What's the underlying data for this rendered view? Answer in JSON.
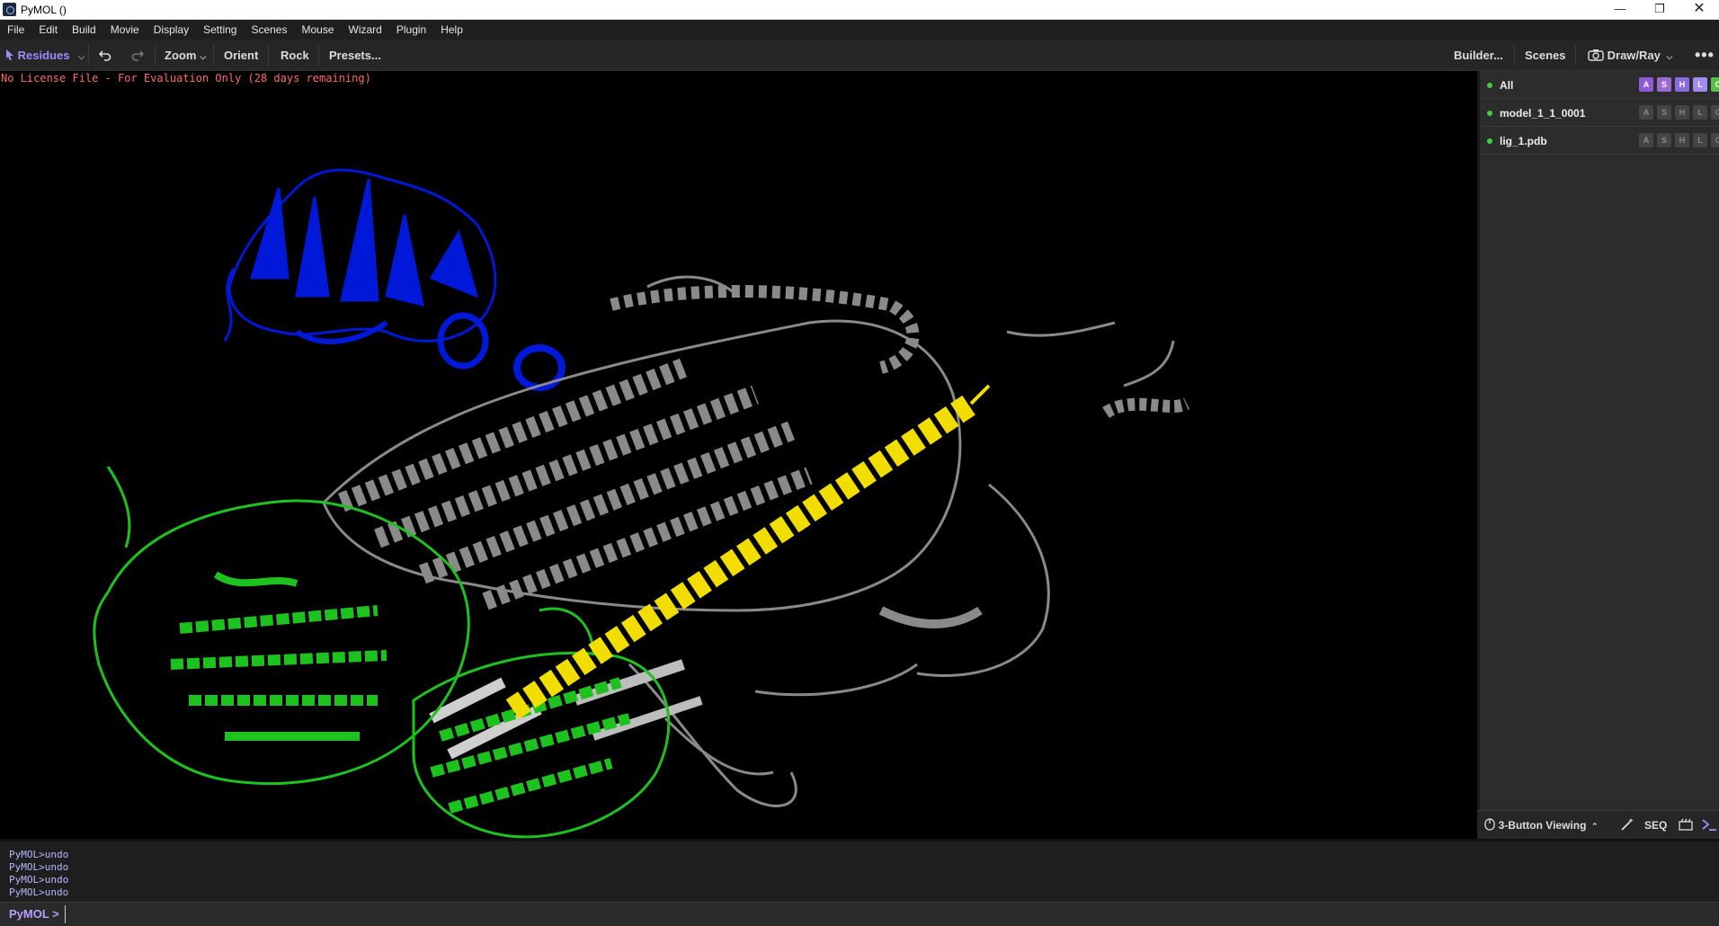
{
  "window": {
    "title": "PyMOL ()",
    "minimize_icon": "minimize-icon",
    "maximize_icon": "restore-icon",
    "close_icon": "close-icon"
  },
  "menu": [
    "File",
    "Edit",
    "Build",
    "Movie",
    "Display",
    "Setting",
    "Scenes",
    "Mouse",
    "Wizard",
    "Plugin",
    "Help"
  ],
  "toolbar": {
    "selection_mode": "Residues",
    "zoom": "Zoom",
    "orient": "Orient",
    "rock": "Rock",
    "presets": "Presets...",
    "builder": "Builder...",
    "scenes": "Scenes",
    "draw_ray": "Draw/Ray",
    "accent": "#9b8cff"
  },
  "viewport": {
    "license_notice": "No License File - For Evaluation Only (28 days remaining)",
    "colors": {
      "chain_blue": "#0018d8",
      "chain_gray": "#8a8a8a",
      "chain_green": "#1ec21e",
      "helix_yellow": "#f2dd00",
      "background": "#000000"
    }
  },
  "objects": [
    {
      "name": "All",
      "buttons": [
        "A",
        "S",
        "H",
        "L",
        "C"
      ],
      "active": true
    },
    {
      "name": "model_1_1_0001",
      "buttons": [
        "A",
        "S",
        "H",
        "L",
        "C"
      ],
      "active": true
    },
    {
      "name": "lig_1.pdb",
      "buttons": [
        "A",
        "S",
        "H",
        "L",
        "C"
      ],
      "active": true
    }
  ],
  "button_colors": {
    "A": "#8b5cd6",
    "S": "#9a6ad6",
    "H": "#8a6ae0",
    "L": "#a08cf0",
    "C": "#58c04a"
  },
  "bottom_panel": {
    "mouse_mode": "3-Button Viewing",
    "seq": "SEQ"
  },
  "console": {
    "lines": [
      "PyMOL>undo",
      "PyMOL>undo",
      "PyMOL>undo",
      "PyMOL>undo"
    ]
  },
  "command": {
    "prompt": "PyMOL >",
    "value": ""
  }
}
